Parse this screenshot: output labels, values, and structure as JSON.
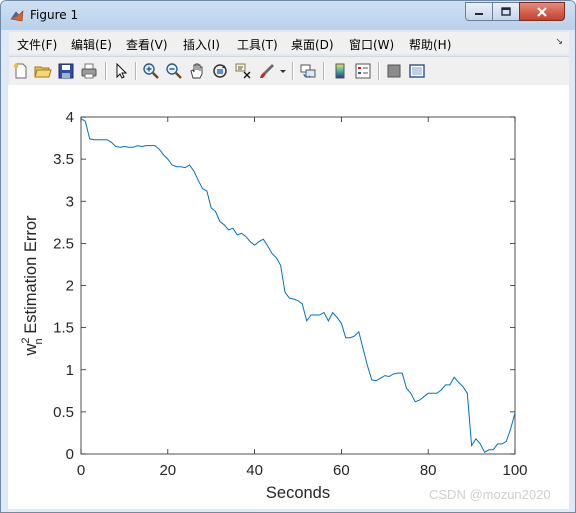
{
  "window": {
    "title": "Figure 1"
  },
  "menubar": {
    "items": [
      "文件(F)",
      "编辑(E)",
      "查看(V)",
      "插入(I)",
      "工具(T)",
      "桌面(D)",
      "窗口(W)",
      "帮助(H)"
    ]
  },
  "toolbar": {
    "icons": [
      "new-figure-icon",
      "open-file-icon",
      "save-icon",
      "print-icon",
      "pointer-icon",
      "zoom-in-icon",
      "zoom-out-icon",
      "pan-icon",
      "rotate-3d-icon",
      "data-cursor-icon",
      "brush-icon",
      "link-plot-icon",
      "colorbar-icon",
      "legend-icon",
      "hide-plot-tools-icon",
      "show-plot-tools-icon"
    ]
  },
  "chart_data": {
    "type": "line",
    "xlabel": "Seconds",
    "ylabel_base": "w",
    "ylabel_sup": "2",
    "ylabel_sub": "n",
    "ylabel_rest": " Estimation Error",
    "xlim": [
      0,
      100
    ],
    "ylim": [
      0,
      4
    ],
    "xticks": [
      "0",
      "20",
      "40",
      "60",
      "80",
      "100"
    ],
    "yticks": [
      "0",
      "0.5",
      "1",
      "1.5",
      "2",
      "2.5",
      "3",
      "3.5",
      "4"
    ],
    "series": [
      {
        "color": "#0072bd",
        "x": [
          0,
          1,
          2,
          3,
          4,
          5,
          6,
          7,
          8,
          9,
          10,
          11,
          12,
          13,
          14,
          15,
          16,
          17,
          18,
          19,
          20,
          21,
          22,
          23,
          24,
          25,
          26,
          27,
          28,
          29,
          30,
          31,
          32,
          33,
          34,
          35,
          36,
          37,
          38,
          39,
          40,
          41,
          42,
          43,
          44,
          45,
          46,
          47,
          48,
          49,
          50,
          51,
          52,
          53,
          54,
          55,
          56,
          57,
          58,
          59,
          60,
          61,
          62,
          63,
          64,
          65,
          66,
          67,
          68,
          69,
          70,
          71,
          72,
          73,
          74,
          75,
          76,
          77,
          78,
          79,
          80,
          81,
          82,
          83,
          84,
          85,
          86,
          87,
          88,
          89,
          90,
          91,
          92,
          93,
          94,
          95,
          96,
          97,
          98,
          99,
          100
        ],
        "y": [
          3.98,
          3.95,
          3.74,
          3.73,
          3.73,
          3.73,
          3.73,
          3.7,
          3.65,
          3.64,
          3.65,
          3.64,
          3.64,
          3.66,
          3.65,
          3.66,
          3.66,
          3.66,
          3.62,
          3.55,
          3.5,
          3.43,
          3.41,
          3.41,
          3.4,
          3.43,
          3.36,
          3.25,
          3.15,
          3.12,
          2.92,
          2.88,
          2.76,
          2.72,
          2.66,
          2.68,
          2.6,
          2.62,
          2.58,
          2.52,
          2.48,
          2.52,
          2.55,
          2.47,
          2.38,
          2.33,
          2.24,
          1.92,
          1.85,
          1.84,
          1.82,
          1.78,
          1.58,
          1.65,
          1.65,
          1.65,
          1.68,
          1.58,
          1.68,
          1.62,
          1.55,
          1.38,
          1.38,
          1.4,
          1.45,
          1.25,
          1.05,
          0.88,
          0.87,
          0.9,
          0.93,
          0.92,
          0.95,
          0.96,
          0.96,
          0.78,
          0.72,
          0.62,
          0.64,
          0.68,
          0.72,
          0.72,
          0.72,
          0.76,
          0.82,
          0.82,
          0.91,
          0.85,
          0.8,
          0.72,
          0.1,
          0.18,
          0.12,
          0.02,
          0.05,
          0.05,
          0.12,
          0.12,
          0.15,
          0.3,
          0.49
        ]
      }
    ]
  },
  "watermark": "CSDN @mozun2020"
}
